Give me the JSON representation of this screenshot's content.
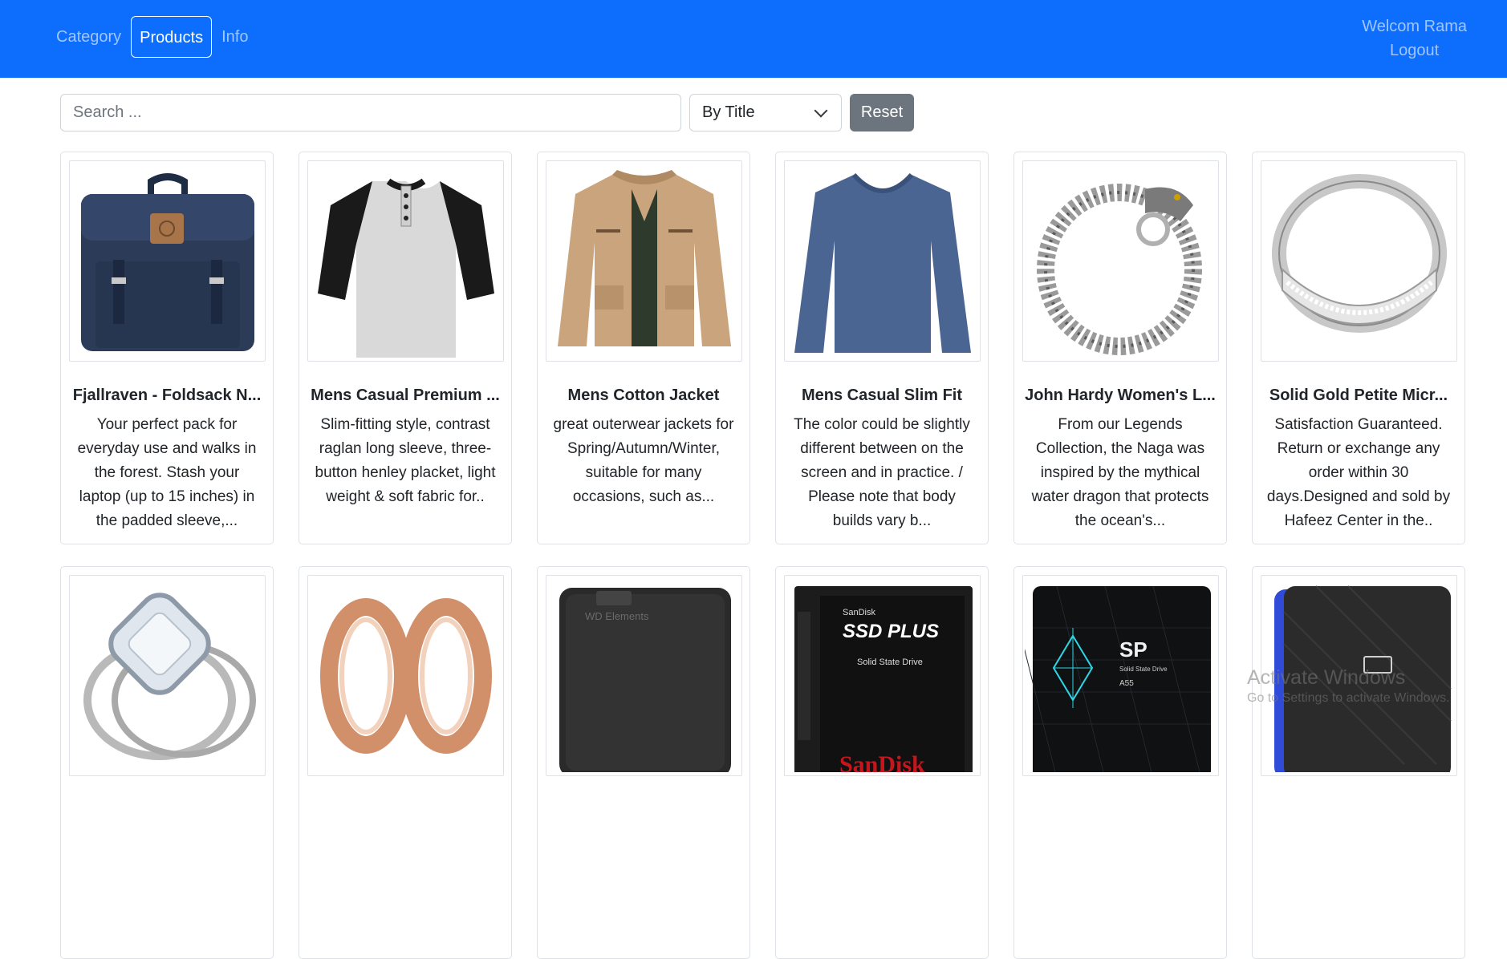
{
  "nav": {
    "items": [
      {
        "label": "Category",
        "active": false
      },
      {
        "label": "Products",
        "active": true
      },
      {
        "label": "Info",
        "active": false
      }
    ],
    "welcome": "Welcom Rama",
    "logout": "Logout",
    "color": "#0d6efd"
  },
  "search": {
    "placeholder": "Search ...",
    "value": "",
    "select_value": "By Title",
    "reset_label": "Reset"
  },
  "products": [
    {
      "title": "Fjallraven - Foldsack N...",
      "desc": "Your perfect pack for everyday use and walks in the forest. Stash your laptop (up to 15 inches) in the padded sleeve,...",
      "icon": "backpack-image"
    },
    {
      "title": "Mens Casual Premium ...",
      "desc": "Slim-fitting style, contrast raglan long sleeve, three-button henley placket, light weight & soft fabric for..",
      "icon": "raglan-tshirt-image"
    },
    {
      "title": "Mens Cotton Jacket",
      "desc": "great outerwear jackets for Spring/Autumn/Winter, suitable for many occasions, such as...",
      "icon": "cotton-jacket-image"
    },
    {
      "title": "Mens Casual Slim Fit",
      "desc": "The color could be slightly different between on the screen and in practice. / Please note that body builds vary b...",
      "icon": "slim-fit-shirt-image"
    },
    {
      "title": "John Hardy Women's L...",
      "desc": "From our Legends Collection, the Naga was inspired by the mythical water dragon that protects the ocean's...",
      "icon": "dragon-bracelet-image"
    },
    {
      "title": "Solid Gold Petite Micr...",
      "desc": "Satisfaction Guaranteed. Return or exchange any order within 30 days.Designed and sold by Hafeez Center in the..",
      "icon": "silver-ring-image"
    },
    {
      "title": "",
      "desc": "",
      "icon": "diamond-ring-image"
    },
    {
      "title": "",
      "desc": "",
      "icon": "rose-gold-plugs-image"
    },
    {
      "title": "",
      "desc": "",
      "icon": "wd-hard-drive-image",
      "image_text": "WD Elements"
    },
    {
      "title": "",
      "desc": "",
      "icon": "sandisk-ssd-image",
      "image_text": [
        "SanDisk",
        "SSD PLUS",
        "Solid State Drive",
        "SanDisk"
      ]
    },
    {
      "title": "",
      "desc": "",
      "icon": "sp-ssd-image",
      "image_text": [
        "SP",
        "Solid State Drive",
        "A55"
      ]
    },
    {
      "title": "",
      "desc": "",
      "icon": "portable-drive-image"
    }
  ],
  "watermark": {
    "line1": "Activate Windows",
    "line2": "Go to Settings to activate Windows."
  }
}
